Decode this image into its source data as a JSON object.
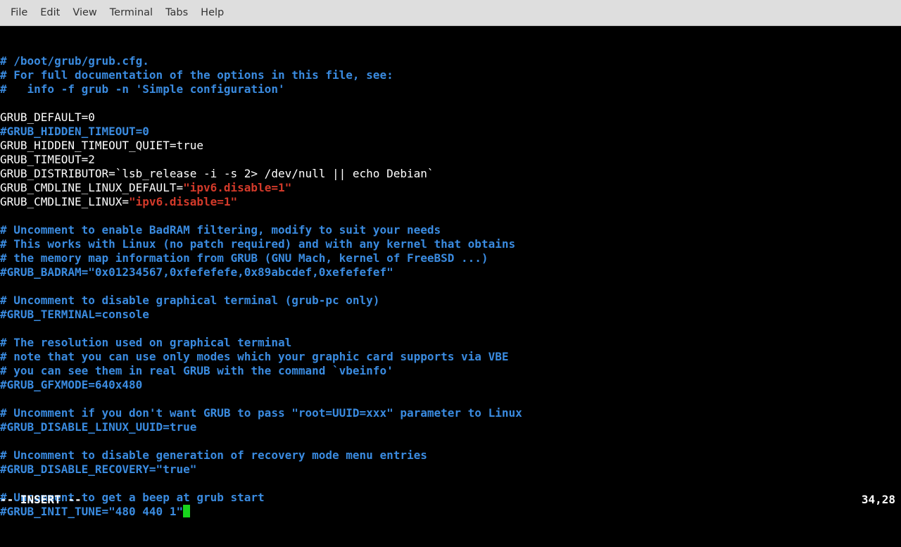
{
  "menubar": {
    "items": [
      "File",
      "Edit",
      "View",
      "Terminal",
      "Tabs",
      "Help"
    ]
  },
  "editor": {
    "file_hint": "/boot/grub/grub.cfg",
    "lines": [
      [
        {
          "c": "comment",
          "t": "# /boot/grub/grub.cfg."
        }
      ],
      [
        {
          "c": "comment",
          "t": "# For full documentation of the options in this file, see:"
        }
      ],
      [
        {
          "c": "comment",
          "t": "#   info -f grub -n 'Simple configuration'"
        }
      ],
      [
        {
          "c": "plain",
          "t": ""
        }
      ],
      [
        {
          "c": "plain",
          "t": "GRUB_DEFAULT=0"
        }
      ],
      [
        {
          "c": "comment",
          "t": "#GRUB_HIDDEN_TIMEOUT=0"
        }
      ],
      [
        {
          "c": "plain",
          "t": "GRUB_HIDDEN_TIMEOUT_QUIET=true"
        }
      ],
      [
        {
          "c": "plain",
          "t": "GRUB_TIMEOUT=2"
        }
      ],
      [
        {
          "c": "plain",
          "t": "GRUB_DISTRIBUTOR=`lsb_release -i -s 2> /dev/null || echo Debian`"
        }
      ],
      [
        {
          "c": "plain",
          "t": "GRUB_CMDLINE_LINUX_DEFAULT="
        },
        {
          "c": "string",
          "t": "\"ipv6.disable=1\""
        }
      ],
      [
        {
          "c": "plain",
          "t": "GRUB_CMDLINE_LINUX="
        },
        {
          "c": "string",
          "t": "\"ipv6.disable=1\""
        }
      ],
      [
        {
          "c": "plain",
          "t": ""
        }
      ],
      [
        {
          "c": "comment",
          "t": "# Uncomment to enable BadRAM filtering, modify to suit your needs"
        }
      ],
      [
        {
          "c": "comment",
          "t": "# This works with Linux (no patch required) and with any kernel that obtains"
        }
      ],
      [
        {
          "c": "comment",
          "t": "# the memory map information from GRUB (GNU Mach, kernel of FreeBSD ...)"
        }
      ],
      [
        {
          "c": "comment",
          "t": "#GRUB_BADRAM=\"0x01234567,0xfefefefe,0x89abcdef,0xefefefef\""
        }
      ],
      [
        {
          "c": "plain",
          "t": ""
        }
      ],
      [
        {
          "c": "comment",
          "t": "# Uncomment to disable graphical terminal (grub-pc only)"
        }
      ],
      [
        {
          "c": "comment",
          "t": "#GRUB_TERMINAL=console"
        }
      ],
      [
        {
          "c": "plain",
          "t": ""
        }
      ],
      [
        {
          "c": "comment",
          "t": "# The resolution used on graphical terminal"
        }
      ],
      [
        {
          "c": "comment",
          "t": "# note that you can use only modes which your graphic card supports via VBE"
        }
      ],
      [
        {
          "c": "comment",
          "t": "# you can see them in real GRUB with the command `vbeinfo'"
        }
      ],
      [
        {
          "c": "comment",
          "t": "#GRUB_GFXMODE=640x480"
        }
      ],
      [
        {
          "c": "plain",
          "t": ""
        }
      ],
      [
        {
          "c": "comment",
          "t": "# Uncomment if you don't want GRUB to pass \"root=UUID=xxx\" parameter to Linux"
        }
      ],
      [
        {
          "c": "comment",
          "t": "#GRUB_DISABLE_LINUX_UUID=true"
        }
      ],
      [
        {
          "c": "plain",
          "t": ""
        }
      ],
      [
        {
          "c": "comment",
          "t": "# Uncomment to disable generation of recovery mode menu entries"
        }
      ],
      [
        {
          "c": "comment",
          "t": "#GRUB_DISABLE_RECOVERY=\"true\""
        }
      ],
      [
        {
          "c": "plain",
          "t": ""
        }
      ],
      [
        {
          "c": "comment",
          "t": "# Uncomment to get a beep at grub start"
        }
      ],
      [
        {
          "c": "comment",
          "t": "#GRUB_INIT_TUNE=\"480 440 1\"",
          "cursor": true
        }
      ]
    ]
  },
  "status": {
    "mode": "-- INSERT --",
    "position": "34,28"
  }
}
